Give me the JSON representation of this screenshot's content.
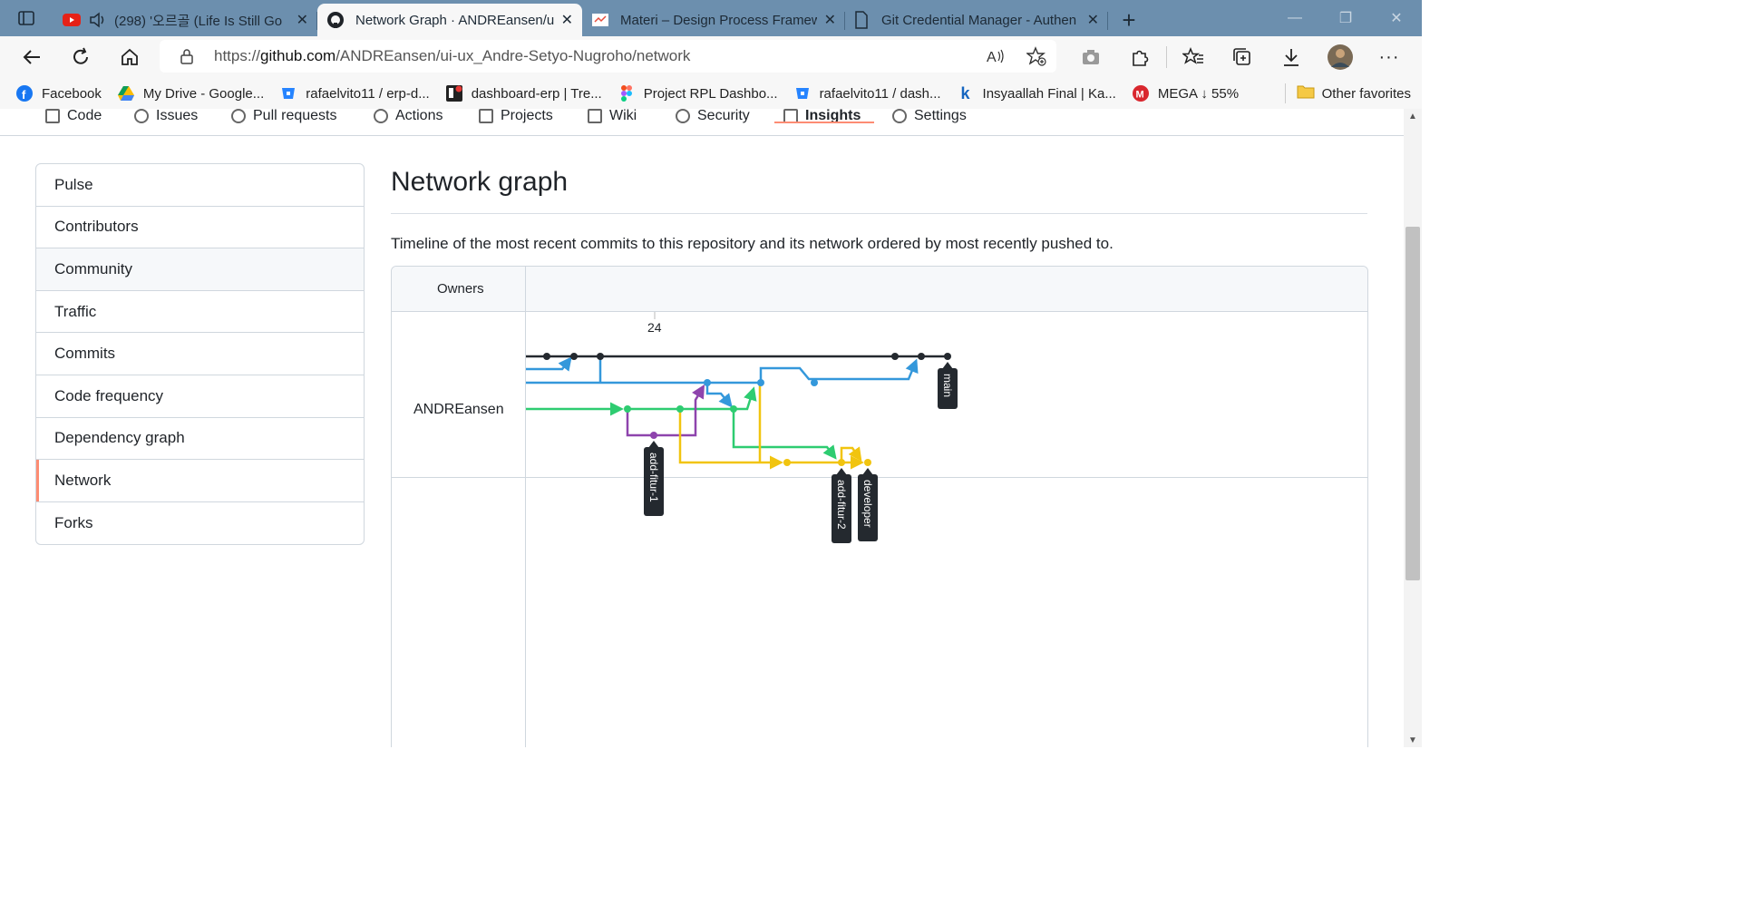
{
  "browser": {
    "tabs": [
      {
        "title": "(298) '오르골 (Life Is Still Go",
        "active": false,
        "icon": "youtube-icon"
      },
      {
        "title": "Network Graph · ANDREansen/ui",
        "active": true,
        "icon": "github-icon"
      },
      {
        "title": "Materi – Design Process Framew",
        "active": false,
        "icon": "page-icon"
      },
      {
        "title": "Git Credential Manager - Authen",
        "active": false,
        "icon": "document-icon"
      }
    ],
    "url_prefix": "https://",
    "url_host": "github.com",
    "url_path": "/ANDREansen/ui-ux_Andre-Setyo-Nugroho/network",
    "favorites": [
      {
        "label": "Facebook",
        "icon": "facebook-icon"
      },
      {
        "label": "My Drive - Google...",
        "icon": "google-drive-icon"
      },
      {
        "label": "rafaelvito11 / erp-d...",
        "icon": "bitbucket-icon"
      },
      {
        "label": "dashboard-erp | Tre...",
        "icon": "trello-icon"
      },
      {
        "label": "Project RPL Dashbo...",
        "icon": "figma-icon"
      },
      {
        "label": "rafaelvito11 / dash...",
        "icon": "bitbucket-icon"
      },
      {
        "label": "Insyaallah Final | Ka...",
        "icon": "k-icon"
      },
      {
        "label": "MEGA ↓ 55%",
        "icon": "mega-icon"
      }
    ],
    "other_favorites": "Other favorites"
  },
  "repo_tabs": [
    "Code",
    "Issues",
    "Pull requests",
    "Actions",
    "Projects",
    "Wiki",
    "Security",
    "Insights",
    "Settings"
  ],
  "sidenav": {
    "items": [
      "Pulse",
      "Contributors",
      "Community",
      "Traffic",
      "Commits",
      "Code frequency",
      "Dependency graph",
      "Network",
      "Forks"
    ],
    "selected": "Network",
    "hovered": "Community"
  },
  "main": {
    "title": "Network graph",
    "description": "Timeline of the most recent commits to this repository and its network ordered by most recently pushed to."
  },
  "network": {
    "owners_label": "Owners",
    "owner": "ANDREansen",
    "date_label": "24",
    "branches": [
      {
        "name": "main",
        "color": "#24292f"
      },
      {
        "name": "add-fitur-1",
        "color": "#8e44ad"
      },
      {
        "name": "add-fitur-2",
        "color": "#f1c40f"
      },
      {
        "name": "developer",
        "color": "#f1c40f"
      }
    ],
    "colors": {
      "black": "#24292f",
      "blue": "#3498db",
      "green": "#2ecc71",
      "purple": "#8e44ad",
      "yellow": "#f1c40f"
    }
  }
}
